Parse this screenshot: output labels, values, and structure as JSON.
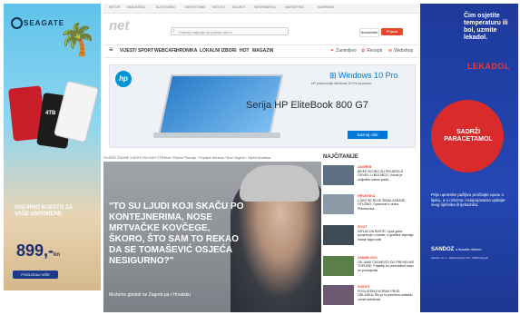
{
  "left_ad": {
    "brand": "SEAGATE",
    "drive_label": "4TB",
    "headline": "SIGURNO MJESTO ZA VAŠE USPOMENE",
    "price": "899,-",
    "price_unit": "kn",
    "cta": "POGLEDAJ VIŠE"
  },
  "site": {
    "top_links": [
      "NETOR",
      "NAMJEŠTAJ",
      "AUTOMOBILI",
      "NEKRETNINE",
      "MOTOCI",
      "SAVJETI",
      "INFORMATIKA",
      "MARKETING",
      "KAMPANJE"
    ],
    "logo": "net",
    "search_placeholder": "Pretraži najbolje na portalu net.hr",
    "btn_login": "Prijava",
    "btn_newsletter": "Newsletter",
    "btn_follow": "Pratite",
    "nav": [
      "VIJESTI",
      "SPORT",
      "WEBCAFE",
      "HRONIKA",
      "LOKALNI IZBORI",
      "HOT",
      "MAGAZIN"
    ],
    "nav_util": [
      "Zanimljivo",
      "Recepti",
      "Webshop"
    ],
    "hp_banner": {
      "hp_logo": "hp",
      "windows": "Windows 10 Pro",
      "windows_sub": "HP preporučuje Windows 10 Pro za posao.",
      "series": "Serija HP EliteBook 800 G7",
      "cta": "Saznaj više"
    },
    "hero": {
      "ticker": "SVJEŽE ČUDNE VIJESTI SA SVIH STRANA / Potres Primorje / Poplave Neretva / Novi Zagreb / Vijesti Hrvatska",
      "caption": "\"TO SU LJUDI KOJI SKAČU PO KONTEJNERIMA, NOSE MRTVAČKE KOVČEGE, ŠKORO, ŠTO SAM TO REKAO DA SE TOMAŠEVIĆ OSJEĆA NESIGURNO?\"",
      "sub": "Možemo gledati ne Zagreb pa i Hrvatsku"
    },
    "sidebar": {
      "heading": "NAJČITANIJE",
      "items": [
        {
          "category": "ZAGREB",
          "text": "BIKER KOJEG SU PRIJATELJI ODVELI U BOLNICU: Vozač je ozlijeđen nakon pada"
        },
        {
          "category": "HRVATSKA",
          "text": "LJUDI SE BOJE ŠEMA ZARAZE OTUŽNO: Opasnost s otoka Plemkovića"
        },
        {
          "category": "ŽIVOT",
          "text": "INFLACIJA RASTE: Ljudi gube povjerenje u banke, a građani osjećaju manje sigurnosti"
        },
        {
          "category": "ZANIMLJIVO",
          "text": "OD JAKE ČEDNOSTI DO PREVELIKE TOPLINE: Prijatelji su iznenađeni kako se promijenila"
        },
        {
          "category": "VIJESTI",
          "text": "POSLJEDNJI KORAK PRIJE ODLASKA: Što je to posebno zatražio vozač autobusa"
        }
      ]
    }
  },
  "right_ad": {
    "headline": "Čim osjetite temperaturu ili bol, uzmite lekadol.",
    "brand": "LEKADOL",
    "product": "SADRŽI PARACETAMOL",
    "disclaimer": "Prije upotrebe pažljivo pročitajte uputu o lijeku, a o rizicima i nuspojavama upitajte svog liječnika ili ljekarnika.",
    "company": "SANDOZ",
    "company_sub": "a Novartis division",
    "address": "Sandoz d.o.o., Maksimirska 120, 10000 Zagreb"
  },
  "colors": {
    "accent": "#e8462b",
    "right_ad_bg": "#2447b3",
    "hp_blue": "#0096d6",
    "windows_blue": "#0078d7"
  }
}
